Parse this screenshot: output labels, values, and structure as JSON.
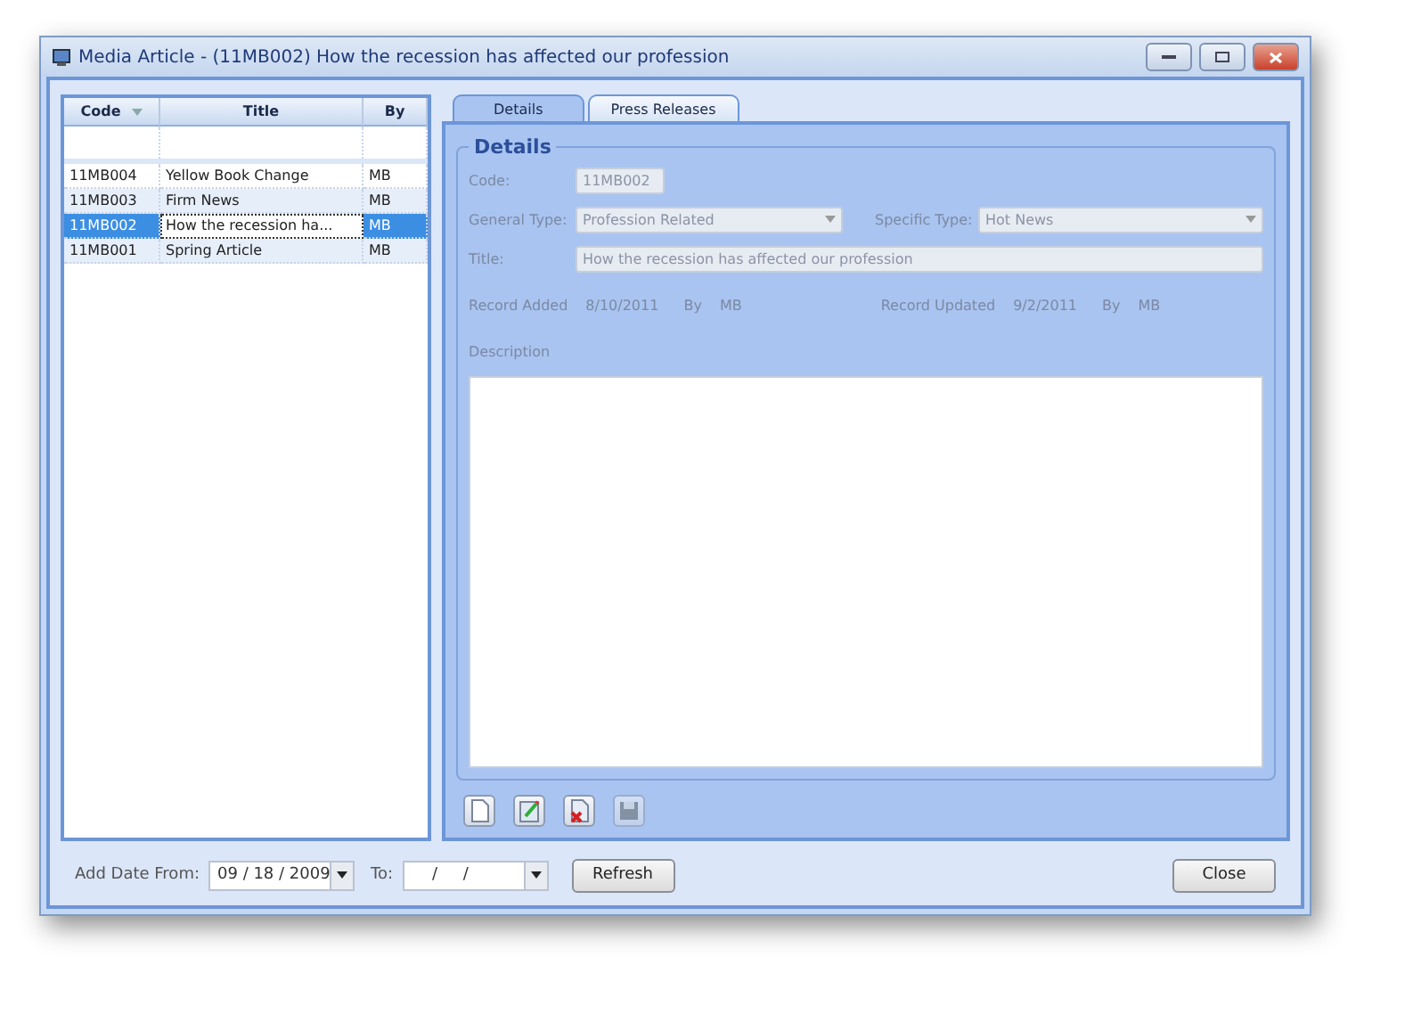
{
  "window": {
    "title": "Media Article - (11MB002) How the recession has affected our profession"
  },
  "grid": {
    "columns": [
      {
        "label": "Code",
        "sortable": true
      },
      {
        "label": "Title",
        "sortable": false
      },
      {
        "label": "By",
        "sortable": false
      }
    ],
    "rows": [
      {
        "code": "11MB004",
        "title": "Yellow Book Change",
        "by": "MB",
        "selected": false
      },
      {
        "code": "11MB003",
        "title": "Firm News",
        "by": "MB",
        "selected": false
      },
      {
        "code": "11MB002",
        "title": "How the recession ha...",
        "by": "MB",
        "selected": true
      },
      {
        "code": "11MB001",
        "title": "Spring Article",
        "by": "MB",
        "selected": false
      }
    ]
  },
  "tabs": [
    {
      "label": "Details",
      "selected": true
    },
    {
      "label": "Press Releases",
      "selected": false
    }
  ],
  "details": {
    "group_title": "Details",
    "code_label": "Code:",
    "code": "11MB002",
    "general_type_label": "General Type:",
    "general_type": "Profession Related",
    "specific_type_label": "Specific Type:",
    "specific_type": "Hot News",
    "title_label": "Title:",
    "title": "How the recession has affected our profession",
    "record_added_label": "Record Added",
    "record_added": "8/10/2011",
    "added_by_label": "By",
    "added_by": "MB",
    "record_updated_label": "Record Updated",
    "record_updated": "9/2/2011",
    "updated_by_label": "By",
    "updated_by": "MB",
    "description_label": "Description"
  },
  "toolbar": [
    {
      "kind": "new",
      "disabled": false
    },
    {
      "kind": "edit",
      "disabled": false
    },
    {
      "kind": "delete",
      "disabled": false
    },
    {
      "kind": "save",
      "disabled": true
    }
  ],
  "footer": {
    "from_label": "Add Date From:",
    "from_value": "09 / 18 / 2009",
    "to_label": "To:",
    "to_value": "/     /",
    "refresh": "Refresh",
    "close": "Close"
  }
}
